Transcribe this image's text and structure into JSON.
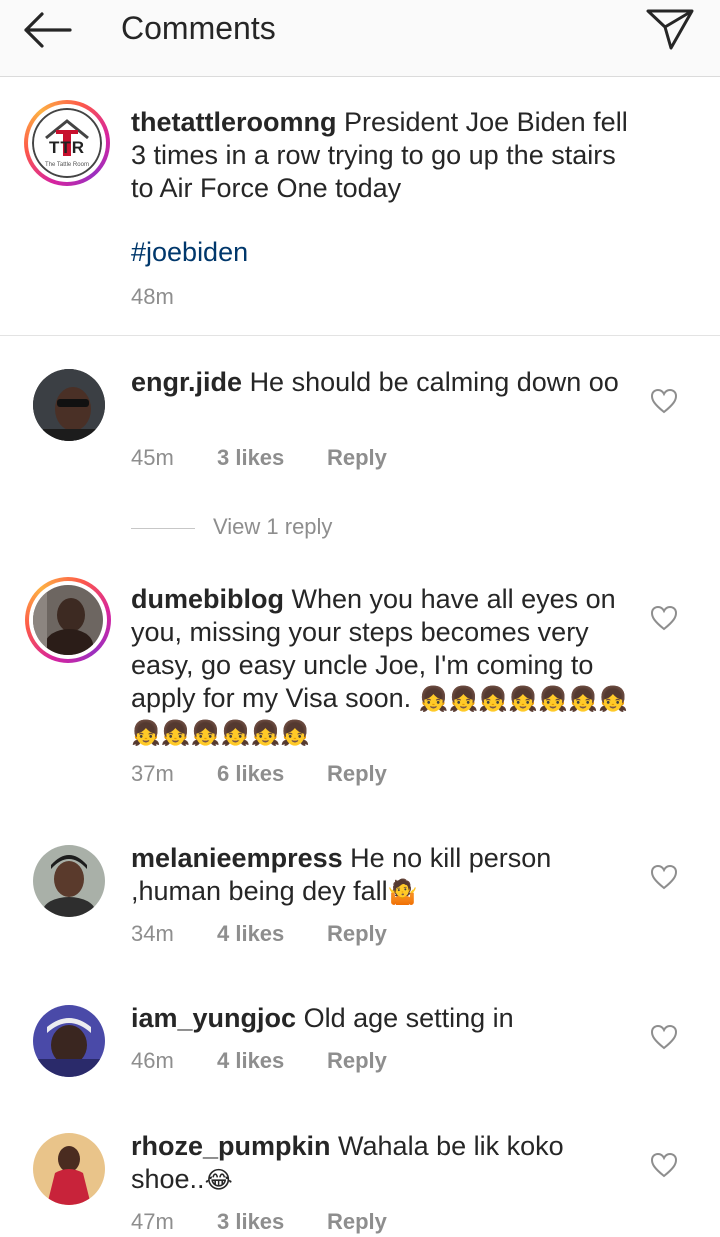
{
  "header": {
    "title": "Comments"
  },
  "caption": {
    "username": "thetattleroomng",
    "text": "President Joe Biden fell 3 times in a row trying to go up the stairs to Air Force One today",
    "hashtag": "#joebiden",
    "time": "48m",
    "avatar_letters": "TTR",
    "avatar_ring_text": "The Tattle Room"
  },
  "view_reply": "View 1 reply",
  "comments": [
    {
      "username": "engr.jide",
      "text": "He should be calming down oo",
      "time": "45m",
      "likes": "3 likes",
      "reply": "Reply"
    },
    {
      "username": "dumebiblog",
      "text": "When you have all eyes on you, missing your steps becomes very easy, go easy uncle Joe, I'm coming to apply for my Visa soon.",
      "emoji": "👧👧👧👧👧👧👧👧👧👧👧👧👧",
      "time": "37m",
      "likes": "6 likes",
      "reply": "Reply"
    },
    {
      "username": "melanieempress",
      "text": "He no kill person ,human being dey fall",
      "emoji": "🤷",
      "time": "34m",
      "likes": "4 likes",
      "reply": "Reply"
    },
    {
      "username": "iam_yungjoc",
      "text": "Old age setting in",
      "time": "46m",
      "likes": "4 likes",
      "reply": "Reply"
    },
    {
      "username": "rhoze_pumpkin",
      "text": "Wahala be lik koko shoe..",
      "emoji": "😂",
      "time": "47m",
      "likes": "3 likes",
      "reply": "Reply"
    }
  ],
  "icons": {
    "back": "arrow-left-icon",
    "share": "paper-plane-icon",
    "like": "heart-outline-icon"
  },
  "colors": {
    "hashtag": "#00376b",
    "muted": "#8e8e8e",
    "text": "#262626",
    "brand_red": "#c8102e"
  }
}
